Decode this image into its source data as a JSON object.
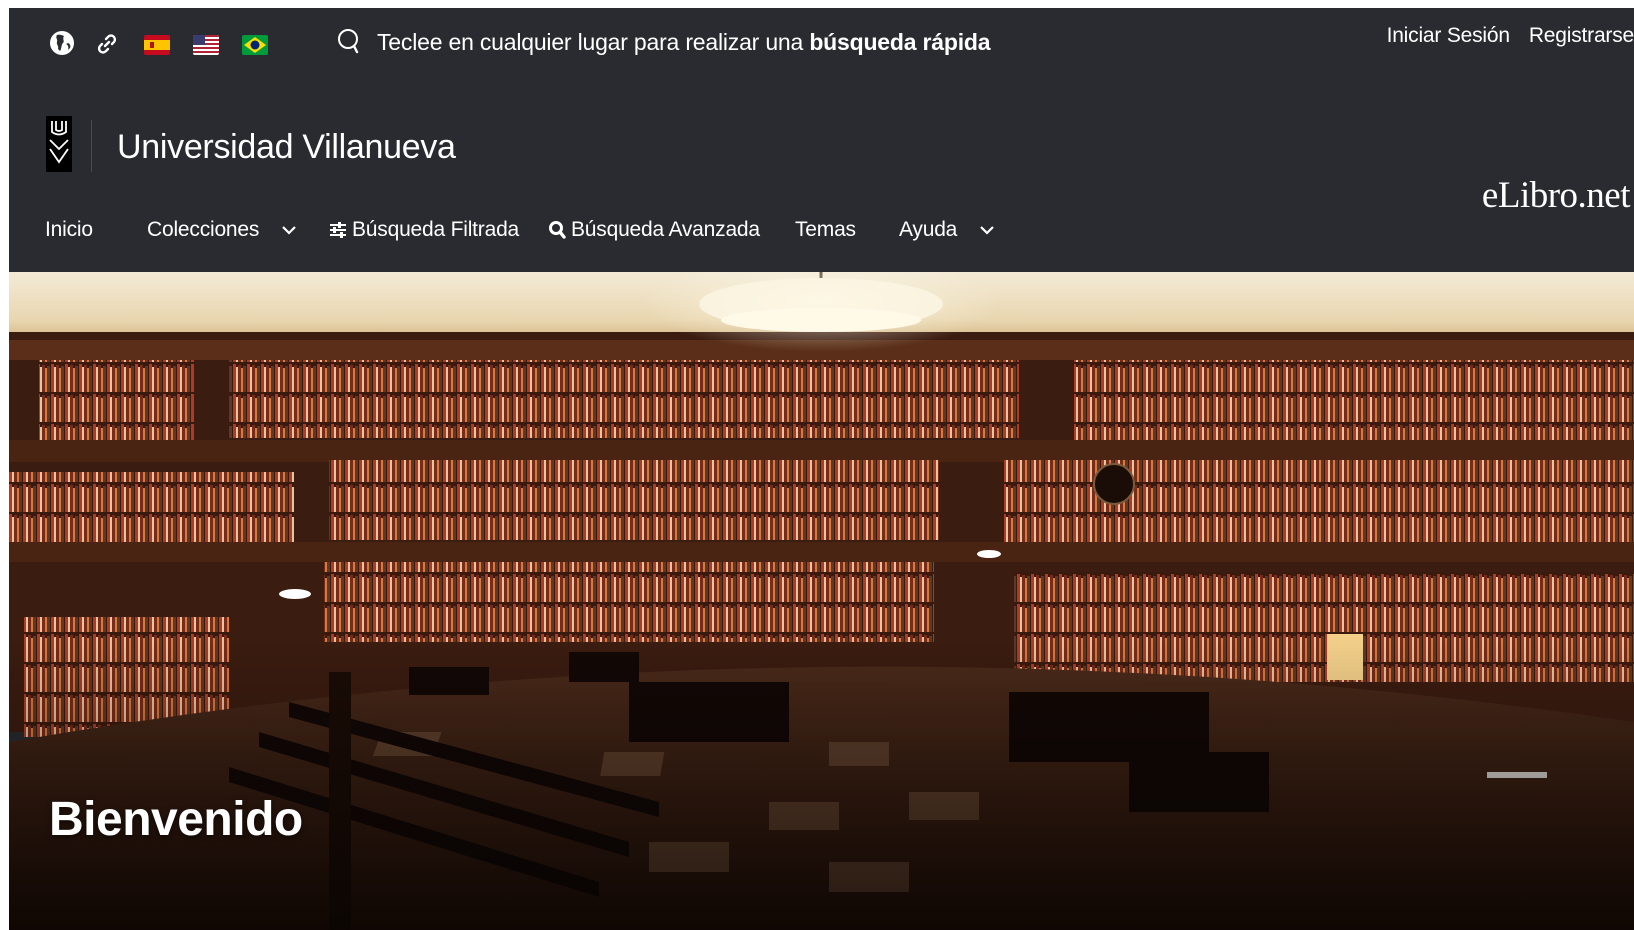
{
  "topbar": {
    "languages": [
      {
        "name": "globe-icon"
      },
      {
        "name": "link-icon"
      },
      {
        "name": "flag-spain"
      },
      {
        "name": "flag-usa"
      },
      {
        "name": "flag-brazil"
      }
    ],
    "quick_search": {
      "prefix": "Teclee en cualquier lugar para realizar una ",
      "emphasis": "búsqueda rápida"
    },
    "login_label": "Iniciar Sesión",
    "register_label": "Registrarse"
  },
  "brand": {
    "university_name": "Universidad Villanueva",
    "platform_logo": "eLibro.net"
  },
  "nav": {
    "inicio": "Inicio",
    "colecciones": "Colecciones",
    "busqueda_filtrada": "Búsqueda Filtrada",
    "busqueda_avanzada": "Búsqueda Avanzada",
    "temas": "Temas",
    "ayuda": "Ayuda"
  },
  "hero": {
    "title": "Bienvenido"
  },
  "colors": {
    "header_bg": "#2a2b30",
    "text": "#ffffff",
    "divider": "#4a4c52"
  }
}
